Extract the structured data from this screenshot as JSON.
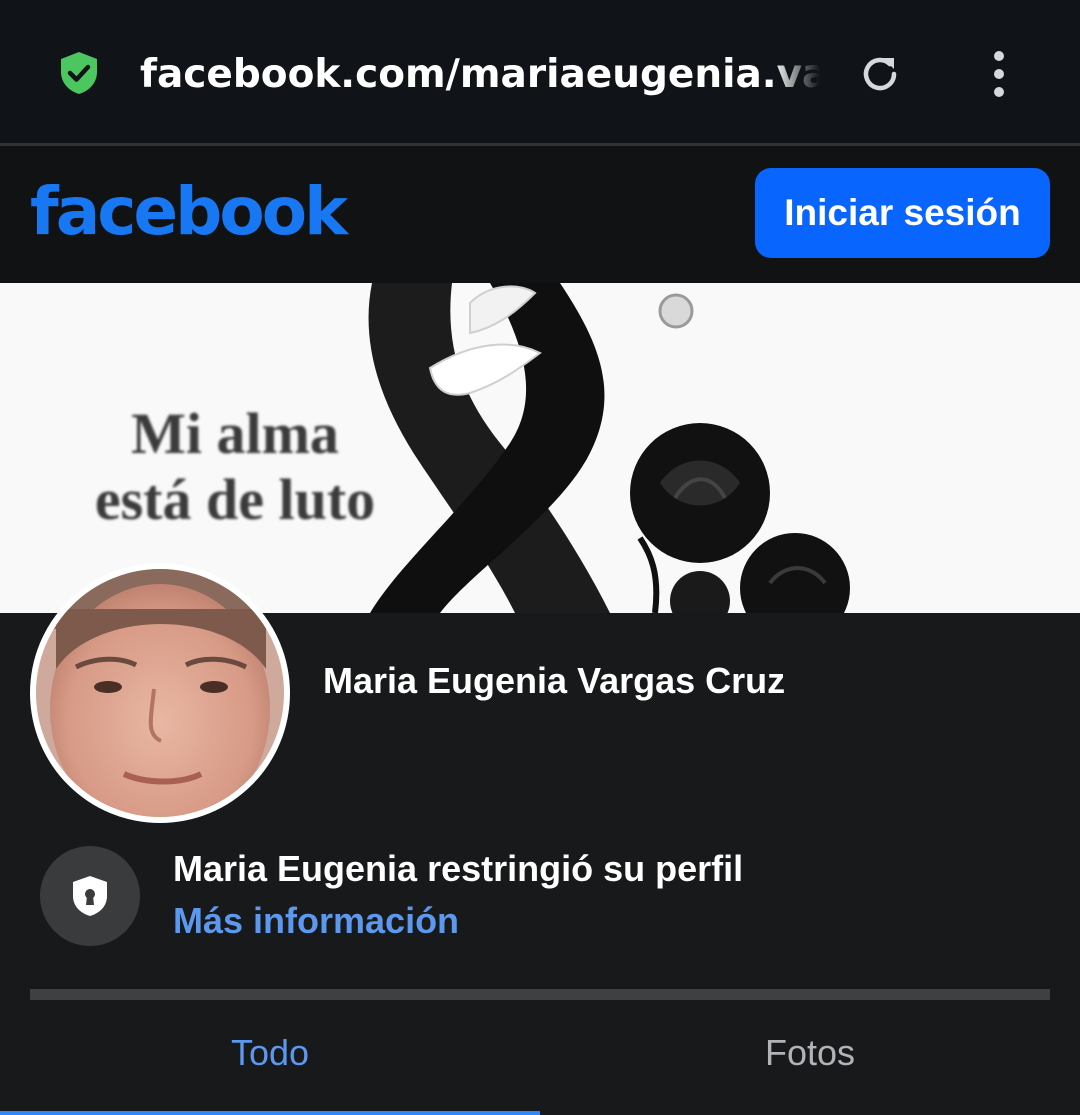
{
  "browser": {
    "url": "facebook.com/mariaeugenia.vargas",
    "icons": {
      "security": "shield-check-icon",
      "reload": "reload-icon",
      "menu": "kebab-menu-icon"
    }
  },
  "header": {
    "logo": "facebook",
    "login_label": "Iniciar sesión"
  },
  "cover": {
    "text_line1": "Mi alma",
    "text_line2": "está de luto"
  },
  "profile": {
    "name": "Maria Eugenia Vargas Cruz",
    "restricted_text": "Maria Eugenia restringió su perfil",
    "more_info": "Más información"
  },
  "tabs": [
    {
      "label": "Todo",
      "active": true
    },
    {
      "label": "Fotos",
      "active": false
    }
  ],
  "colors": {
    "brand_blue": "#1877f2",
    "button_blue": "#0866ff",
    "link_blue": "#5b98ee",
    "background": "#18191a"
  }
}
